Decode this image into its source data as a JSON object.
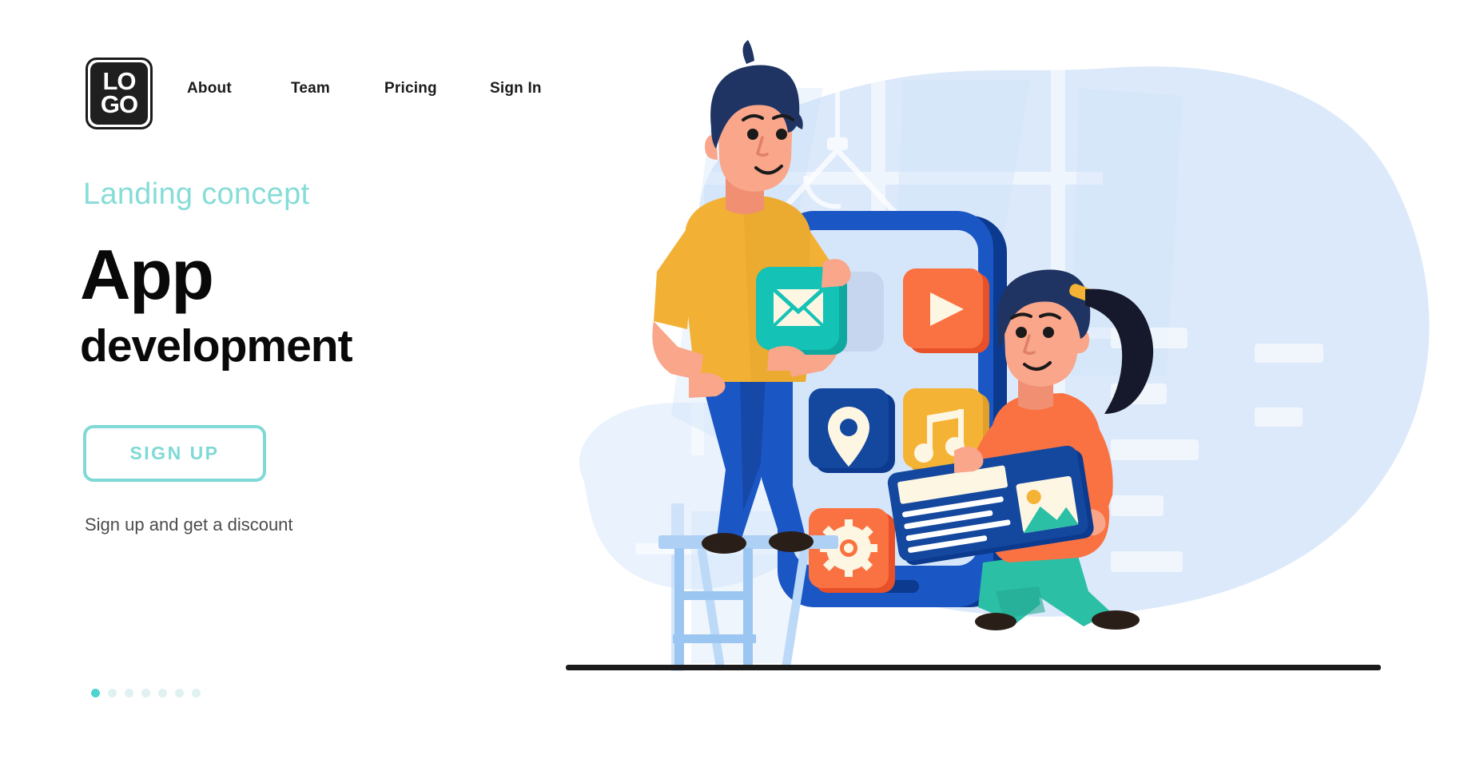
{
  "header": {
    "logo": {
      "line1": "LO",
      "line2": "GO",
      "alt": "LOGO"
    },
    "nav": [
      {
        "label": "About"
      },
      {
        "label": "Team"
      },
      {
        "label": "Pricing"
      },
      {
        "label": "Sign In"
      }
    ],
    "overflow_menu": "more-options"
  },
  "hero": {
    "eyebrow": "Landing concept",
    "title_line1": "App",
    "title_line2": "development",
    "cta_label": "SIGN UP",
    "tagline": "Sign up and get a discount",
    "carousel": {
      "total": 7,
      "active_index": 0
    }
  },
  "colors": {
    "accent_teal": "#7fd9d6",
    "eyebrow_teal": "#86dcd8",
    "dot_active": "#4fd4cd",
    "dot_inactive": "#dff1f0",
    "heading_black": "#090909",
    "tagline_gray": "#4c4c4c",
    "blob_blue": "#d9e9fb",
    "phone_blue": "#1a56c4",
    "phone_dark": "#0b3a8f",
    "screen_blue": "#d6e6fa",
    "icon_teal": "#14c2b6",
    "icon_orange": "#f9703e",
    "icon_navy": "#14489e",
    "icon_yellow": "#f5b335",
    "shirt_yellow": "#f2b134",
    "shirt_orange": "#f9703e",
    "pants_blue": "#1a56c4",
    "pants_teal": "#2bbfa6",
    "skin": "#f9a68a",
    "hair_navy": "#1f3462",
    "ground_black": "#1b1b1b"
  },
  "illustration": {
    "name": "app-development-illustration",
    "scene_elements": [
      "background-blob",
      "window-frame",
      "hanging-lamp",
      "smartphone",
      "step-ladder",
      "man-character",
      "woman-character",
      "ground-line"
    ],
    "app_icons": [
      {
        "name": "mail-icon",
        "label": "Mail",
        "color": "#14c2b6"
      },
      {
        "name": "play-icon",
        "label": "Video",
        "color": "#f9703e"
      },
      {
        "name": "location-pin-icon",
        "label": "Maps",
        "color": "#14489e"
      },
      {
        "name": "music-note-icon",
        "label": "Music",
        "color": "#f5b335"
      },
      {
        "name": "gear-icon",
        "label": "Settings",
        "color": "#f9703e"
      }
    ],
    "held_card": {
      "name": "content-card",
      "has_image_thumbnail": true,
      "text_line_count": 5
    }
  }
}
